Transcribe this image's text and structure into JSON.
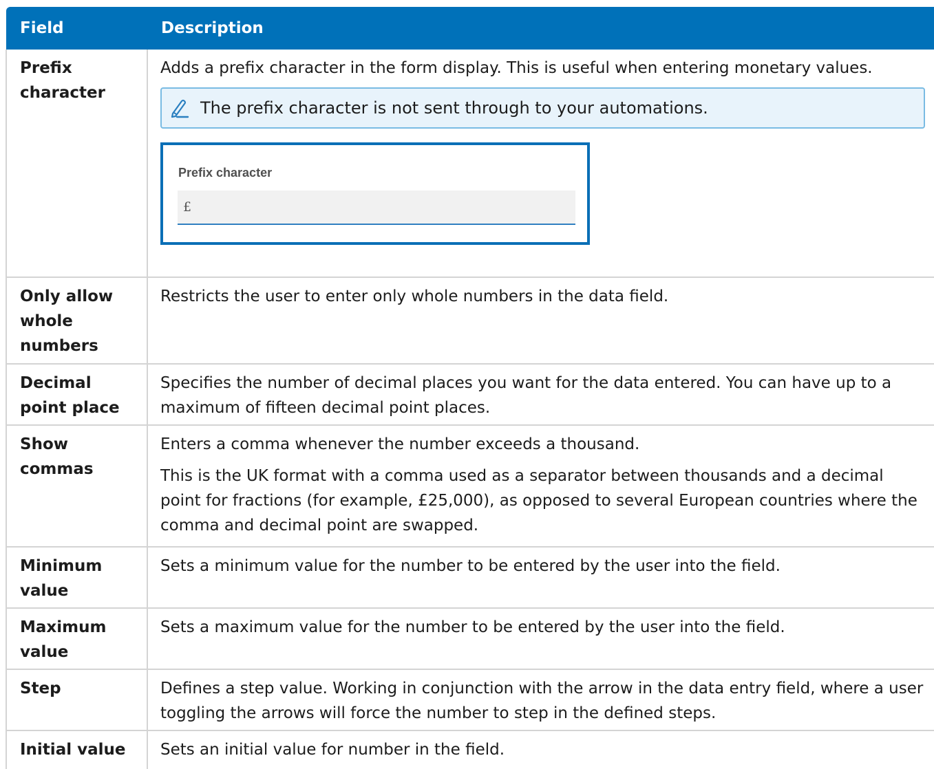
{
  "header": {
    "field": "Field",
    "description": "Description"
  },
  "rows": [
    {
      "field": "Prefix character",
      "desc": [
        "Adds a prefix character in the form display. This is useful when entering monetary values."
      ],
      "note": "The prefix character is not sent through to your automations.",
      "example": {
        "label": "Prefix character",
        "value": "£"
      }
    },
    {
      "field": "Only allow whole numbers",
      "desc": [
        "Restricts the user to enter only whole numbers in the data field."
      ]
    },
    {
      "field": "Decimal point place",
      "desc": [
        "Specifies the number of decimal places you want for the data entered. You can have up to a maximum of fifteen decimal point places."
      ]
    },
    {
      "field": "Show commas",
      "desc": [
        "Enters a comma whenever the number exceeds a thousand.",
        "This is the UK format with a comma used as a separator between thousands and a decimal point for fractions (for example, £25,000), as opposed to several European countries where the comma and decimal point are swapped."
      ]
    },
    {
      "field": "Minimum value",
      "desc": [
        "Sets a minimum value for the number to be entered by the user into the field."
      ]
    },
    {
      "field": "Maximum value",
      "desc": [
        "Sets a maximum value for the number to be entered by the user into the field."
      ]
    },
    {
      "field": "Step",
      "desc": [
        "Defines a step value. Working in conjunction with the arrow in the data entry field, where a user toggling the arrows will force the number to step in the defined steps."
      ]
    },
    {
      "field": "Initial value",
      "desc": [
        "Sets an initial value for number in the field."
      ]
    }
  ],
  "icons": {
    "note": "pencil-note-icon"
  },
  "colors": {
    "header_bg": "#0071b9",
    "note_bg": "#e8f3fb",
    "note_border": "#79bbe3",
    "example_border": "#0b6fb6"
  }
}
